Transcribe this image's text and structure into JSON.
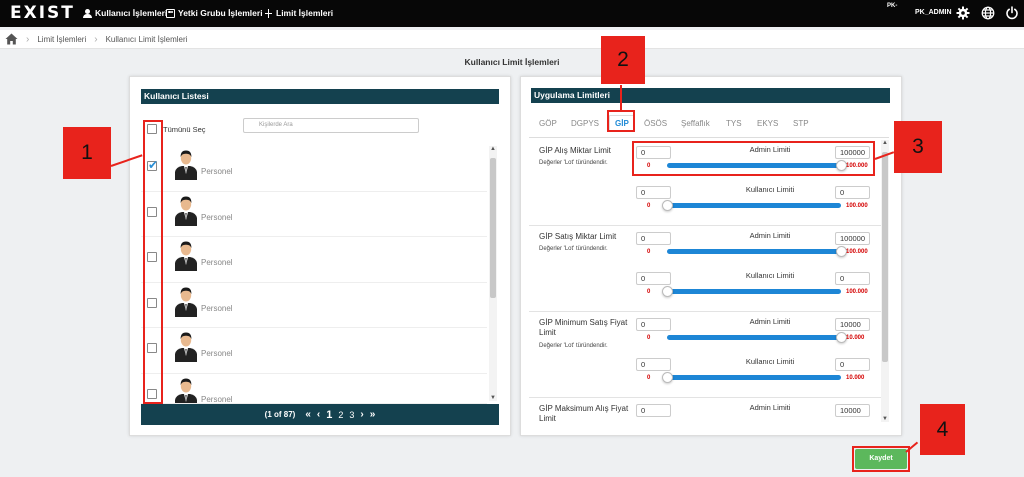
{
  "app": {
    "logo": "EXIST",
    "nav": [
      {
        "label": "Kullanıcı İşlemleri",
        "icon": "user-icon"
      },
      {
        "label": "Yetki Grubu İşlemleri",
        "icon": "group-icon"
      },
      {
        "label": "Limit İşlemleri",
        "icon": "limit-icon"
      }
    ],
    "pk_label": "PK-",
    "username": "PK_ADMIN"
  },
  "breadcrumb": {
    "items": [
      "Limit İşlemleri",
      "Kullanıcı Limit İşlemleri"
    ]
  },
  "page_title": "Kullanıcı Limit İşlemleri",
  "user_list": {
    "title": "Kullanıcı Listesi",
    "select_all": "Tümünü Seç",
    "search_placeholder": "Kişilerde Ara",
    "rows": [
      {
        "label": "Personel",
        "checked": true
      },
      {
        "label": "Personel",
        "checked": false
      },
      {
        "label": "Personel",
        "checked": false
      },
      {
        "label": "Personel",
        "checked": false
      },
      {
        "label": "Personel",
        "checked": false
      },
      {
        "label": "Personel",
        "checked": false
      }
    ],
    "pager": {
      "info": "(1 of 87)",
      "first": "«",
      "prev": "‹",
      "pages": [
        "1",
        "2",
        "3"
      ],
      "next": "›",
      "last": "»"
    }
  },
  "limits": {
    "title": "Uygulama Limitleri",
    "tabs": [
      "GÖP",
      "DGPYS",
      "GİP",
      "ÖSÖS",
      "Şeffaflık",
      "TYS",
      "EKYS",
      "STP"
    ],
    "active_tab": "GİP",
    "sections": [
      {
        "title": "GİP Alış Miktar Limit",
        "note": "Değerler 'Lot' türündendir.",
        "admin": {
          "label": "Admin Limiti",
          "min": "0",
          "max": "100000",
          "range_min": "0",
          "range_max": "100.000",
          "level": 1.0
        },
        "user": {
          "label": "Kullanıcı Limiti",
          "min": "0",
          "max": "0",
          "range_min": "0",
          "range_max": "100.000",
          "level": 0.0
        }
      },
      {
        "title": "GİP Satış Miktar Limit",
        "note": "Değerler 'Lot' türündendir.",
        "admin": {
          "label": "Admin Limiti",
          "min": "0",
          "max": "100000",
          "range_min": "0",
          "range_max": "100.000",
          "level": 1.0
        },
        "user": {
          "label": "Kullanıcı Limiti",
          "min": "0",
          "max": "0",
          "range_min": "0",
          "range_max": "100.000",
          "level": 0.0
        }
      },
      {
        "title": "GİP Minimum Satış Fiyat Limit",
        "note": "Değerler 'Lot' türündendir.",
        "admin": {
          "label": "Admin Limiti",
          "min": "0",
          "max": "10000",
          "range_min": "0",
          "range_max": "10.000",
          "level": 1.0
        },
        "user": {
          "label": "Kullanıcı Limiti",
          "min": "0",
          "max": "0",
          "range_min": "0",
          "range_max": "10.000",
          "level": 0.0
        }
      },
      {
        "title": "GİP Maksimum Alış Fiyat Limit",
        "admin": {
          "label": "Admin Limiti",
          "min": "0",
          "max": "10000"
        }
      }
    ]
  },
  "save_button": "Kaydet",
  "annotations": [
    "1",
    "2",
    "3",
    "4"
  ],
  "colors": {
    "topbar": "#070707",
    "panel_header": "#14414f",
    "accent_blue": "#1d86d6",
    "range_red": "#d40000",
    "save_green": "#5cb85c",
    "annotation_red": "#e8231c"
  }
}
